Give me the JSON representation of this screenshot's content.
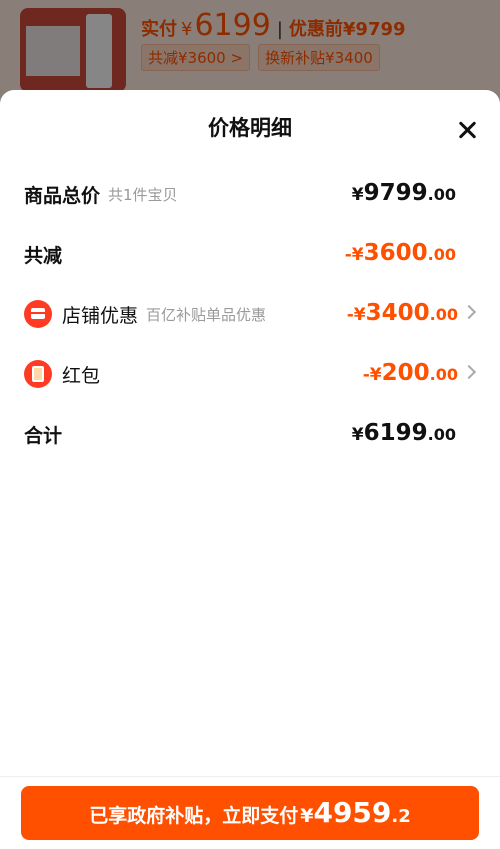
{
  "header_product": {
    "paid_label": "实付",
    "currency": "¥",
    "paid_amount": "6199",
    "separator": "|",
    "before_label": "优惠前¥9799",
    "tags": [
      "共减¥3600 >",
      "换新补贴¥3400"
    ]
  },
  "sheet": {
    "title": "价格明细",
    "rows": [
      {
        "label": "商品总价",
        "sub": "共1件宝贝",
        "currency": "¥",
        "int": "9799",
        "dec": ".00",
        "style": "black"
      },
      {
        "label": "共减",
        "sub": "",
        "currency": "-¥",
        "int": "3600",
        "dec": ".00",
        "style": "orange"
      },
      {
        "label": "店铺优惠",
        "sub": "百亿补贴单品优惠",
        "currency": "-¥",
        "int": "3400",
        "dec": ".00",
        "style": "orange",
        "icon": "shop-icon"
      },
      {
        "label": "红包",
        "sub": "",
        "currency": "-¥",
        "int": "200",
        "dec": ".00",
        "style": "orange",
        "icon": "red-packet-icon"
      },
      {
        "label": "合计",
        "sub": "",
        "currency": "¥",
        "int": "6199",
        "dec": ".00",
        "style": "black"
      }
    ]
  },
  "pay_button": {
    "text": "已享政府补贴，立即支付",
    "currency": "¥",
    "int": "4959",
    "dec": ".2"
  },
  "colors": {
    "accent": "#ff5000",
    "icon_red": "#ff3b24"
  }
}
